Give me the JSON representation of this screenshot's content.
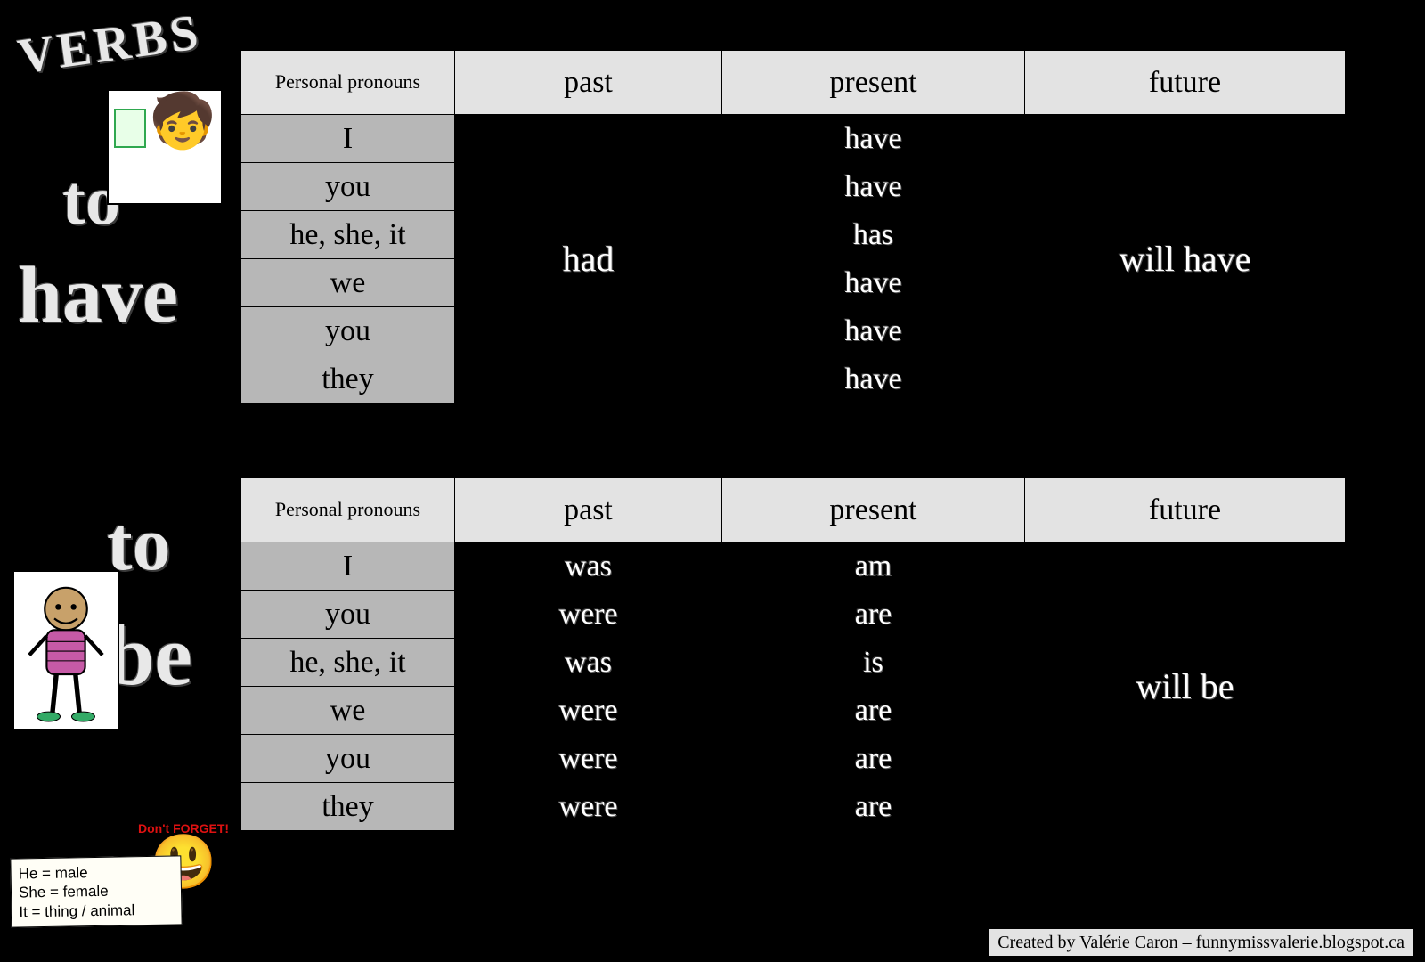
{
  "titles": {
    "verbs": "VERBS",
    "to_have_line1": "to",
    "to_have_line2": "have",
    "to_be_line1": "to",
    "to_be_line2": "be"
  },
  "headers": {
    "pronouns": "Personal pronouns",
    "past": "past",
    "present": "present",
    "future": "future"
  },
  "have": {
    "pronouns": [
      "I",
      "you",
      "he, she, it",
      "we",
      "you",
      "they"
    ],
    "past": "had",
    "present": [
      "have",
      "have",
      "has",
      "have",
      "have",
      "have"
    ],
    "future": "will have"
  },
  "be": {
    "pronouns": [
      "I",
      "you",
      "he, she, it",
      "we",
      "you",
      "they"
    ],
    "past": [
      "was",
      "were",
      "was",
      "were",
      "were",
      "were"
    ],
    "present": [
      "am",
      "are",
      "is",
      "are",
      "are",
      "are"
    ],
    "future": "will be"
  },
  "dont_forget_label": "Don't FORGET!",
  "legend": {
    "he": "He = male",
    "she": "She = female",
    "it": "It = thing / animal"
  },
  "credit": "Created by Valérie Caron – funnymissvalerie.blogspot.ca",
  "chart_data": [
    {
      "type": "table",
      "title": "to have",
      "columns": [
        "Personal pronouns",
        "past",
        "present",
        "future"
      ],
      "rows": [
        [
          "I",
          "had",
          "have",
          "will have"
        ],
        [
          "you",
          "had",
          "have",
          "will have"
        ],
        [
          "he, she, it",
          "had",
          "has",
          "will have"
        ],
        [
          "we",
          "had",
          "have",
          "will have"
        ],
        [
          "you",
          "had",
          "have",
          "will have"
        ],
        [
          "they",
          "had",
          "have",
          "will have"
        ]
      ]
    },
    {
      "type": "table",
      "title": "to be",
      "columns": [
        "Personal pronouns",
        "past",
        "present",
        "future"
      ],
      "rows": [
        [
          "I",
          "was",
          "am",
          "will be"
        ],
        [
          "you",
          "were",
          "are",
          "will be"
        ],
        [
          "he, she, it",
          "was",
          "is",
          "will be"
        ],
        [
          "we",
          "were",
          "are",
          "will be"
        ],
        [
          "you",
          "were",
          "are",
          "will be"
        ],
        [
          "they",
          "were",
          "are",
          "will be"
        ]
      ]
    }
  ]
}
